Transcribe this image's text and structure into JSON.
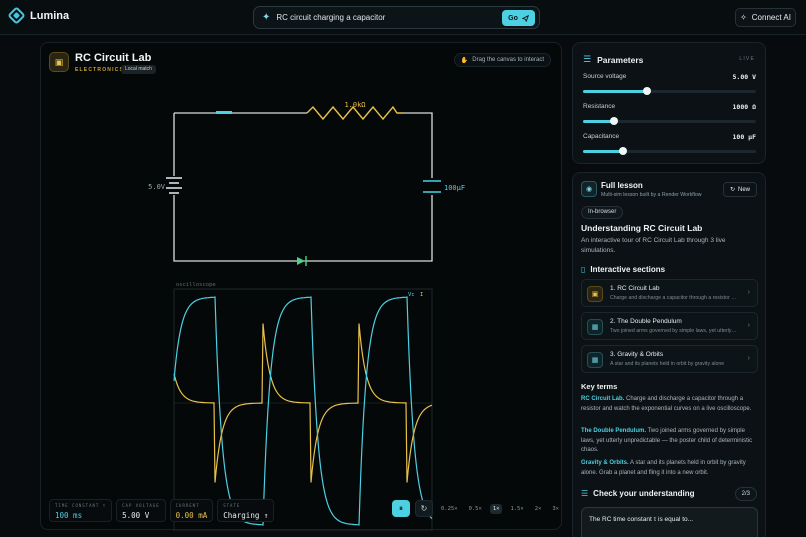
{
  "app": {
    "name": "Lumina"
  },
  "search": {
    "value": "RC circuit charging a capacitor",
    "go_label": "Go"
  },
  "header": {
    "connect_label": "Connect AI"
  },
  "lab": {
    "title": "RC Circuit Lab",
    "category": "ELECTRONICS",
    "badge": "Local match",
    "drag_hint": "Drag the canvas to interact",
    "circuit": {
      "resistor_label": "1.0kΩ",
      "source_label": "5.0V",
      "capacitor_label": "100μF",
      "scope_title": "oscilloscope",
      "scope_legend_vc": "Vc",
      "scope_legend_i": "I"
    },
    "stats": [
      {
        "label": "TIME CONSTANT τ",
        "value": "100 ms",
        "color": "#4dd0e1"
      },
      {
        "label": "CAP VOLTAGE",
        "value": "5.00 V",
        "color": "#e8eef0"
      },
      {
        "label": "CURRENT",
        "value": "0.00 mA",
        "color": "#e8c14a"
      },
      {
        "label": "STATE",
        "value": "Charging ↑",
        "color": "#e8eef0"
      }
    ],
    "speeds": [
      "0.25×",
      "0.5×",
      "1×",
      "1.5×",
      "2×",
      "3×"
    ],
    "active_speed": "1×",
    "colors": {
      "accent": "#4dd0e1",
      "current": "#e8c14a",
      "wire": "#d8dfe2"
    }
  },
  "params": {
    "title": "Parameters",
    "live": "LIVE",
    "items": [
      {
        "label": "Source voltage",
        "value": "5.00 V",
        "fraction": 0.37
      },
      {
        "label": "Resistance",
        "value": "1000 Ω",
        "fraction": 0.18
      },
      {
        "label": "Capacitance",
        "value": "100 μF",
        "fraction": 0.23
      }
    ]
  },
  "lesson": {
    "title": "Full lesson",
    "subtitle": "Multi-sim lesson built by a Render Workflow",
    "new_label": "New",
    "tag": "In-browser",
    "heading": "Understanding RC Circuit Lab",
    "description": "An interactive tour of RC Circuit Lab through 3 live simulations.",
    "sections_title": "Interactive sections",
    "sections": [
      {
        "title": "1. RC Circuit Lab",
        "desc": "Charge and discharge a capacitor through a resistor and watch the exponential curves",
        "icon": "circuit-icon"
      },
      {
        "title": "2. The Double Pendulum",
        "desc": "Two joined arms governed by simple laws, yet utterly unpredictable",
        "icon": "pendulum-icon"
      },
      {
        "title": "3. Gravity & Orbits",
        "desc": "A star and its planets held in orbit by gravity alone",
        "icon": "orbit-icon"
      }
    ],
    "key_terms_title": "Key terms",
    "terms": [
      {
        "term": "RC Circuit Lab.",
        "text": "Charge and discharge a capacitor through a resistor and watch the exponential curves on a live oscilloscope."
      },
      {
        "term": "The Double Pendulum.",
        "text": "Two joined arms governed by simple laws, yet utterly unpredictable — the poster child of deterministic chaos."
      },
      {
        "term": "Gravity & Orbits.",
        "text": "A star and its planets held in orbit by gravity alone. Grab a planet and fling it into a new orbit."
      }
    ],
    "check_title": "Check your understanding",
    "pager": "2/3",
    "question": "The RC time constant τ is equal to..."
  }
}
